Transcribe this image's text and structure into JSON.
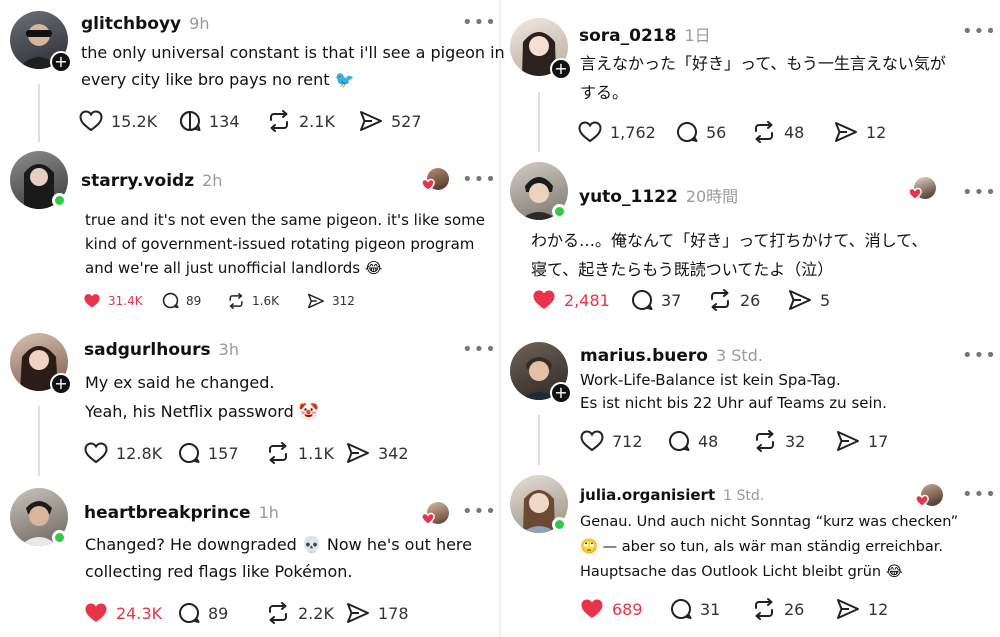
{
  "left": {
    "posts": [
      {
        "user": "glitchboyy",
        "time": "9h",
        "lines": [
          "the only universal constant is that i'll see a pigeon in",
          "every city like bro pays no rent 🐦"
        ],
        "likes": "15.2K",
        "replies": "134",
        "reposts": "2.1K",
        "shares": "527",
        "liked": false
      },
      {
        "user": "starry.voidz",
        "time": "2h",
        "lines": [
          "true and it's not even the same pigeon. it's like some",
          "kind of government-issued rotating pigeon program",
          "and we're all just unofficial landlords 😂"
        ],
        "likes": "31.4K",
        "replies": "89",
        "reposts": "1.6K",
        "shares": "312",
        "liked": true
      },
      {
        "user": "sadgurlhours",
        "time": "3h",
        "lines": [
          "My ex said he changed.",
          "Yeah, his Netflix password 🤡"
        ],
        "likes": "12.8K",
        "replies": "157",
        "reposts": "1.1K",
        "shares": "342",
        "liked": false
      },
      {
        "user": "heartbreakprince",
        "time": "1h",
        "lines": [
          "Changed? He downgraded 💀  Now he's out here",
          "collecting red flags like Pokémon."
        ],
        "likes": "24.3K",
        "replies": "89",
        "reposts": "2.2K",
        "shares": "178",
        "liked": true
      }
    ]
  },
  "right": {
    "posts": [
      {
        "user": "sora_0218",
        "time": "1日",
        "lines": [
          "言えなかった「好き」って、もう一生言えない気が",
          "する。"
        ],
        "likes": "1,762",
        "replies": "56",
        "reposts": "48",
        "shares": "12",
        "liked": false
      },
      {
        "user": "yuto_1122",
        "time": "20時間",
        "lines": [
          "わかる…。俺なんて「好き」って打ちかけて、消して、",
          "寝て、起きたらもう既読ついてたよ（泣）"
        ],
        "likes": "2,481",
        "replies": "37",
        "reposts": "26",
        "shares": "5",
        "liked": true
      },
      {
        "user": "marius.buero",
        "time": "3 Std.",
        "lines": [
          "Work-Life-Balance ist kein Spa-Tag.",
          "Es ist nicht bis 22 Uhr auf Teams zu sein."
        ],
        "likes": "712",
        "replies": "48",
        "reposts": "32",
        "shares": "17",
        "liked": false
      },
      {
        "user": "julia.organisiert",
        "time": "1 Std.",
        "lines": [
          "Genau. Und auch nicht Sonntag “kurz was checken”",
          "🙄 — aber so tun, als wär man ständig erreichbar.",
          "Hauptsache das Outlook Licht bleibt grün 😂"
        ],
        "likes": "689",
        "replies": "31",
        "reposts": "26",
        "shares": "12",
        "liked": true
      }
    ]
  },
  "icons": {
    "like": "heart-icon",
    "reply": "reply-bubble-icon",
    "repost": "repost-icon",
    "share": "share-icon",
    "more": "more-icon",
    "follow": "plus-icon"
  },
  "colors": {
    "liked": "#e8334a",
    "online": "#2ecc40",
    "meta": "#9a9a9a"
  }
}
